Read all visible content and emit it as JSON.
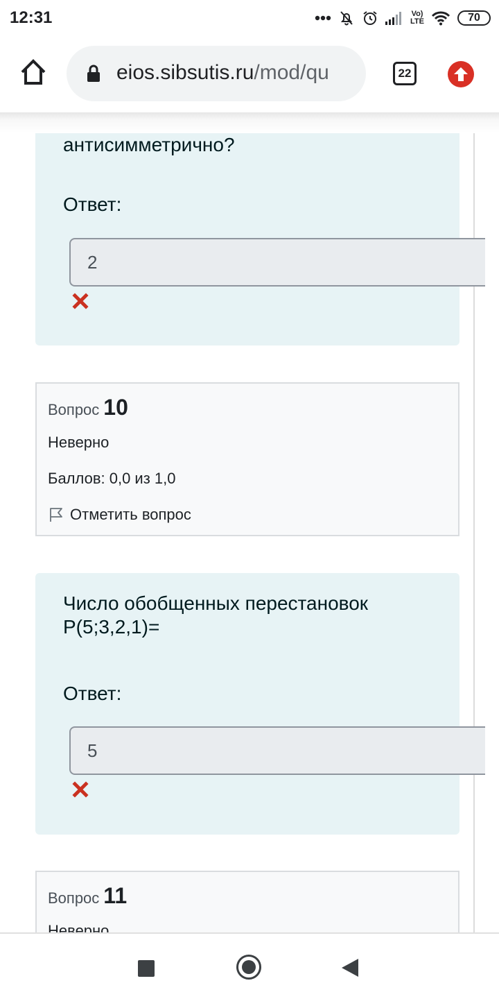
{
  "status_bar": {
    "time": "12:31",
    "volte_top": "Vo)",
    "volte_bottom": "LTE",
    "battery": "70"
  },
  "browser": {
    "url_domain": "eios.sibsutis.ru",
    "url_path": "/mod/qu",
    "tab_count": "22",
    "update_color": "#d93025"
  },
  "questions": [
    {
      "text": "антисимметрично?",
      "answer_label": "Ответ:",
      "answer_value": "2",
      "result_icon": "wrong-cross-icon"
    },
    {
      "info": {
        "label": "Вопрос",
        "number": "10",
        "state": "Неверно",
        "grade": "Баллов: 0,0 из 1,0",
        "flag": "Отметить вопрос"
      },
      "text": "Число обобщенных перестановок P(5;3,2,1)=",
      "answer_label": "Ответ:",
      "answer_value": "5",
      "result_icon": "wrong-cross-icon"
    },
    {
      "info": {
        "label": "Вопрос",
        "number": "11",
        "state": "Неверно"
      }
    }
  ],
  "colors": {
    "question_bg": "#e7f3f5",
    "info_bg": "#f8f9fa",
    "wrong": "#ca3120"
  }
}
